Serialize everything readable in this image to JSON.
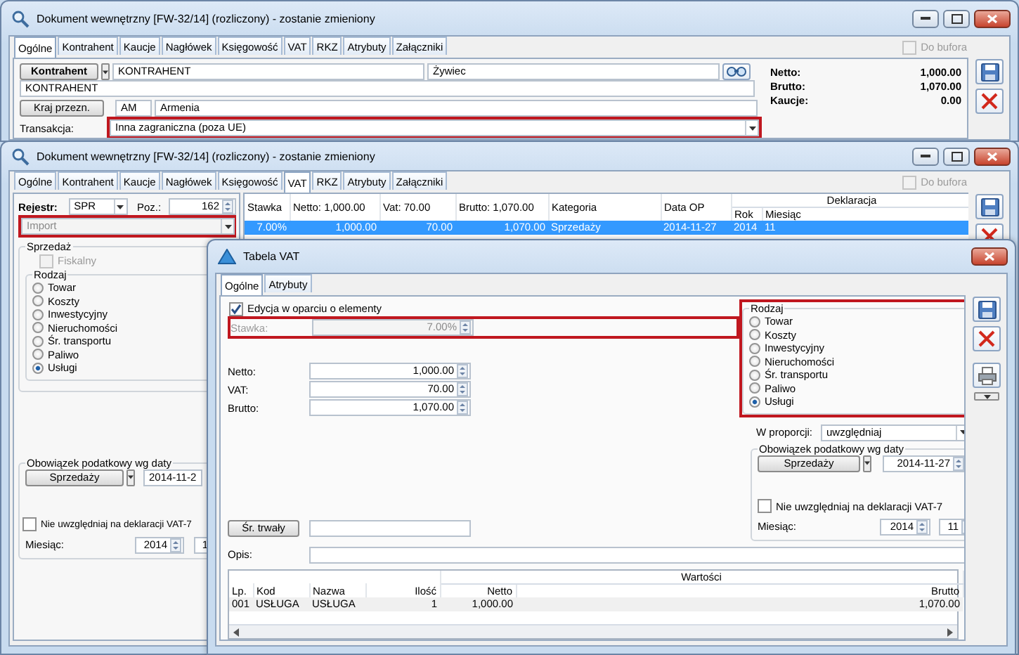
{
  "document_window": {
    "title": "Dokument wewnętrzny [FW-32/14] (rozliczony) - zostanie zmieniony",
    "tabs": [
      {
        "label": "Ogólne",
        "selected": true
      },
      {
        "label": "Kontrahent",
        "selected": false
      },
      {
        "label": "Kaucje",
        "selected": false
      },
      {
        "label": "Nagłówek",
        "selected": false
      },
      {
        "label": "Księgowość",
        "selected": false
      },
      {
        "label": "VAT",
        "selected": false
      },
      {
        "label": "RKZ",
        "selected": false
      },
      {
        "label": "Atrybuty",
        "selected": false
      },
      {
        "label": "Załączniki",
        "selected": false
      }
    ],
    "do_bufora": {
      "label": "Do bufora",
      "checked": false,
      "disabled": true
    },
    "kontrahent_button": "Kontrahent",
    "kontrahent_code": "KONTRAHENT",
    "kontrahent_city": "Żywiec",
    "kontrahent_name": "KONTRAHENT",
    "kraj_button": "Kraj przezn.",
    "kraj_code": "AM",
    "kraj_name": "Armenia",
    "transakcja": {
      "label": "Transakcja:",
      "value": "Inna zagraniczna (poza UE)",
      "highlighted": true
    },
    "totals": [
      {
        "label": "Netto:",
        "value": "1,000.00"
      },
      {
        "label": "Brutto:",
        "value": "1,070.00"
      },
      {
        "label": "Kaucje:",
        "value": "0.00"
      }
    ]
  },
  "vat_window": {
    "title": "Dokument wewnętrzny [FW-32/14] (rozliczony) - zostanie zmieniony",
    "tabs": [
      {
        "label": "Ogólne",
        "selected": false
      },
      {
        "label": "Kontrahent",
        "selected": false
      },
      {
        "label": "Kaucje",
        "selected": false
      },
      {
        "label": "Nagłówek",
        "selected": false
      },
      {
        "label": "Księgowość",
        "selected": false
      },
      {
        "label": "VAT",
        "selected": true
      },
      {
        "label": "RKZ",
        "selected": false
      },
      {
        "label": "Atrybuty",
        "selected": false
      },
      {
        "label": "Załączniki",
        "selected": false
      }
    ],
    "do_bufora": {
      "label": "Do bufora",
      "checked": false,
      "disabled": true
    },
    "rejestr": {
      "label": "Rejestr:",
      "value": "SPR"
    },
    "poz": {
      "label": "Poz.:",
      "value": "162"
    },
    "kategoria": {
      "value": "Import",
      "highlighted": true
    },
    "sprzedaz": {
      "title": "Sprzedaż",
      "fiskalny": {
        "label": "Fiskalny",
        "checked": false,
        "disabled": true
      },
      "rodzaj_title": "Rodzaj",
      "rodzaj": [
        {
          "label": "Towar",
          "selected": false
        },
        {
          "label": "Koszty",
          "selected": false
        },
        {
          "label": "Inwestycyjny",
          "selected": false
        },
        {
          "label": "Nieruchomości",
          "selected": false
        },
        {
          "label": "Śr. transportu",
          "selected": false
        },
        {
          "label": "Paliwo",
          "selected": false
        },
        {
          "label": "Usługi",
          "selected": true
        }
      ]
    },
    "obowiazek": {
      "title": "Obowiązek podatkowy wg daty",
      "button": "Sprzedaży",
      "date": "2014-11-2"
    },
    "nie_uwzgledniaj": {
      "label": "Nie uwzględniaj na deklaracji VAT-7",
      "checked": false
    },
    "miesiac": {
      "label": "Miesiąc:",
      "year": "2014",
      "month": "1"
    },
    "table": {
      "columns": [
        "Stawka",
        "Netto: 1,000.00",
        "Vat: 70.00",
        "Brutto: 1,070.00",
        "Kategoria",
        "Data OP"
      ],
      "group": "Deklaracja",
      "group_columns": [
        "Rok",
        "Miesiąc"
      ],
      "rows": [
        {
          "cells": [
            "7.00%",
            "1,000.00",
            "70.00",
            "1,070.00",
            "Sprzedaży",
            "2014-11-27",
            "2014",
            "11"
          ],
          "selected": true
        }
      ]
    }
  },
  "vat_dialog": {
    "title": "Tabela VAT",
    "tabs": [
      {
        "label": "Ogólne",
        "selected": true
      },
      {
        "label": "Atrybuty",
        "selected": false
      }
    ],
    "edycja": {
      "label": "Edycja w oparciu o elementy",
      "checked": true
    },
    "stawka": {
      "label": "Stawka:",
      "value": "7.00%",
      "disabled": true,
      "highlighted": true
    },
    "amounts": [
      {
        "label": "Netto:",
        "value": "1,000.00"
      },
      {
        "label": "VAT:",
        "value": "70.00"
      },
      {
        "label": "Brutto:",
        "value": "1,070.00"
      }
    ],
    "rodzaj": {
      "title": "Rodzaj",
      "highlighted": true,
      "options": [
        {
          "label": "Towar",
          "selected": false
        },
        {
          "label": "Koszty",
          "selected": false
        },
        {
          "label": "Inwestycyjny",
          "selected": false
        },
        {
          "label": "Nieruchomości",
          "selected": false
        },
        {
          "label": "Śr. transportu",
          "selected": false
        },
        {
          "label": "Paliwo",
          "selected": false
        },
        {
          "label": "Usługi",
          "selected": true
        }
      ]
    },
    "w_proporcji": {
      "label": "W proporcji:",
      "value": "uwzględniaj"
    },
    "obowiazek": {
      "title": "Obowiązek podatkowy wg daty",
      "button": "Sprzedaży",
      "date": "2014-11-27"
    },
    "nie_uwzgledniaj": {
      "label": "Nie uwzględniaj na deklaracji VAT-7",
      "checked": false
    },
    "miesiac": {
      "label": "Miesiąc:",
      "year": "2014",
      "month": "11"
    },
    "sr_trwaly_button": "Śr. trwały",
    "opis": {
      "label": "Opis:"
    },
    "items": {
      "columns": [
        "Lp.",
        "Kod",
        "Nazwa",
        "Ilość"
      ],
      "group": "Wartości",
      "group_columns": [
        "Netto",
        "Brutto"
      ],
      "rows": [
        {
          "cells": [
            "001",
            "USŁUGA",
            "USŁUGA",
            "1",
            "1,000.00",
            "1,070.00"
          ]
        }
      ]
    }
  }
}
